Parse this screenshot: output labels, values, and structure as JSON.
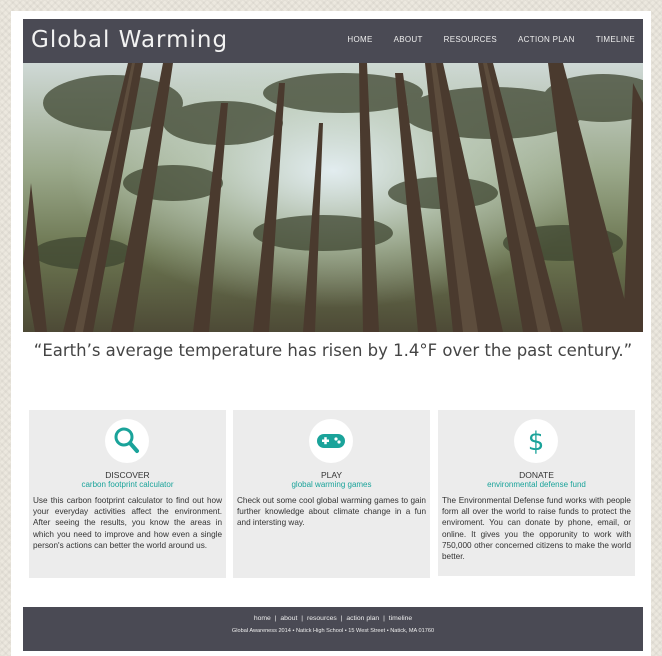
{
  "site": {
    "title": "Global Warming"
  },
  "nav": {
    "home": "HOME",
    "about": "ABOUT",
    "resources": "RESOURCES",
    "action_plan": "ACTION PLAN",
    "timeline": "TIMELINE"
  },
  "hero": {
    "quote": "“Earth’s average temperature has risen by 1.4°F over the past century.”"
  },
  "cards": [
    {
      "icon": "magnifier-icon",
      "title": "DISCOVER",
      "subtitle": "carbon footprint calculator",
      "desc": "Use this carbon footprint calculator to find out how your everyday activities affect the environment. After seeing the results, you know the areas in which you need to improve and how even a single person's actions can better the world around us."
    },
    {
      "icon": "gamepad-icon",
      "title": "PLAY",
      "subtitle": "global warming games",
      "desc": "Check out some cool global warming games to gain further knowledge about climate change in a fun and intersting way."
    },
    {
      "icon": "dollar-icon",
      "title": "DONATE",
      "subtitle": "environmental defense fund",
      "desc": "The Environmental Defense fund works with people form all over the world to raise funds to protect the enviroment. You can donate by phone, email, or online. It gives you the opporunity to work with 750,000 other concerned citizens to make the world better."
    }
  ],
  "footer": {
    "links": [
      "home",
      "about",
      "resources",
      "action plan",
      "timeline"
    ],
    "separator": "|",
    "info": "Global Awareness 2014 • Natick High School • 15 West Street • Natick, MA 01760"
  },
  "colors": {
    "header_bg": "#4a4a54",
    "accent": "#1aa39a",
    "card_bg": "#ececec"
  }
}
